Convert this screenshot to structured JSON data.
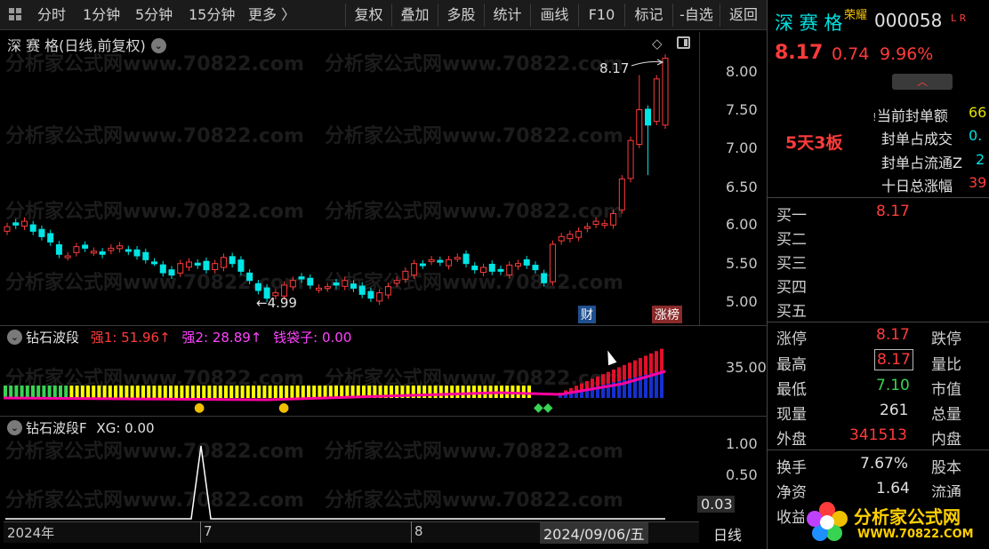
{
  "toolbar": {
    "left_items": [
      "分时",
      "1分钟",
      "5分钟",
      "15分钟",
      "更多 〉"
    ],
    "buttons": [
      "复权",
      "叠加",
      "多股",
      "统计",
      "画线",
      "F10",
      "标记",
      "-自选",
      "返回"
    ]
  },
  "chart": {
    "title": "深 赛 格(日线,前复权)",
    "high_label": "8.17",
    "low_label": "←4.99",
    "tag_cai": "财",
    "tag_zhangbang": "涨榜",
    "watermark": "分析家公式网www.70822.com",
    "price_ticks": [
      "8.00",
      "7.50",
      "7.00",
      "6.50",
      "6.00",
      "5.50",
      "5.00"
    ]
  },
  "indicator1": {
    "name": "钻石波段",
    "s1": "强1: 51.96↑",
    "s2": "强2: 28.89↑",
    "s3": "钱袋子: 0.00",
    "tick": "35.00"
  },
  "indicator2": {
    "name": "钻石波段F",
    "xg": "XG: 0.00",
    "ticks": [
      "1.00",
      "0.50",
      "0.03"
    ]
  },
  "date_axis": {
    "labels": [
      "2024年",
      "7",
      "8"
    ],
    "cursor_date": "2024/09/06/五",
    "period": "日线"
  },
  "colors": {
    "up": "#ff3b3b",
    "down": "#00e5e5",
    "green": "#39d353",
    "magenta": "#ff00ff",
    "yellow": "#ffff00"
  },
  "panel": {
    "name": "深 赛 格",
    "tag": "荣耀",
    "code": "000058",
    "lr": "L R",
    "price": "8.17",
    "change": "0.74",
    "pct": "9.96%",
    "board": "5天3板",
    "seal_rows": [
      {
        "label": "当前封单额",
        "value": "66"
      },
      {
        "label": "封单占成交",
        "value": "0."
      },
      {
        "label": "封单占流通Z",
        "value": "2"
      },
      {
        "label": "十日总涨幅",
        "value": "39"
      }
    ],
    "book_labels": [
      "买一",
      "买二",
      "买三",
      "买四",
      "买五"
    ],
    "buy1": "8.17",
    "quote": [
      {
        "k1": "涨停",
        "v1": "8.17",
        "c1": "red",
        "k2": "跌停"
      },
      {
        "k1": "最高",
        "v1": "8.17",
        "c1": "red",
        "k2": "量比"
      },
      {
        "k1": "最低",
        "v1": "7.10",
        "c1": "green",
        "k2": "市值"
      },
      {
        "k1": "现量",
        "v1": "261",
        "c1": "white",
        "k2": "总量"
      },
      {
        "k1": "外盘",
        "v1": "341513",
        "c1": "red",
        "k2": "内盘"
      }
    ],
    "quote2": [
      {
        "k1": "换手",
        "v1": "7.67%",
        "k2": "股本"
      },
      {
        "k1": "净资",
        "v1": "1.64",
        "k2": "流通"
      },
      {
        "k1": "收益",
        "v1": "",
        "k2": ""
      }
    ]
  },
  "logo": {
    "cn": "分析家公式网",
    "url": "WWW.70822.COM"
  }
}
